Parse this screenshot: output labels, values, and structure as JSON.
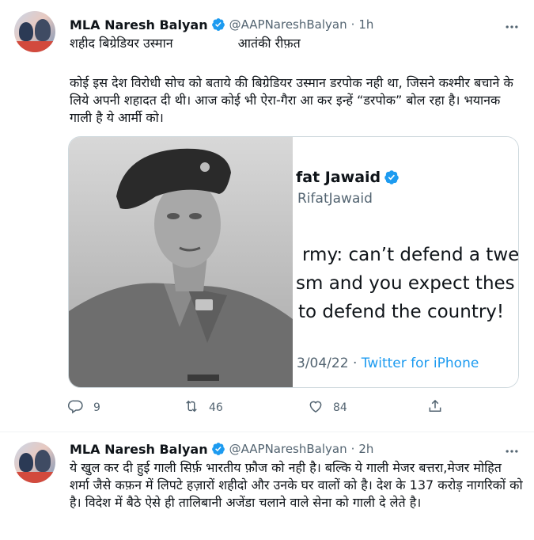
{
  "tweets": [
    {
      "author": "MLA Naresh Balyan",
      "handle": "@AAPNareshBalyan",
      "separator": "·",
      "time": "1h",
      "line1_left": "शहीद बिग्रेडियर उस्मान",
      "line1_right": "आतंकी रीफ़त",
      "body": "कोई इस देश विरोधी सोच को बताये की बिग्रेडियर उस्मान डरपोक नही था, जिसने कश्मीर बचाने के लिये अपनी शहादत दी थी। आज कोई भी ऐरा-गैरा आ कर इन्हें “डरपोक” बोल रहा है। भयानक गाली है ये आर्मी को।",
      "embedded": {
        "name": "fat Jawaid",
        "handle": "RifatJawaid",
        "line_a": "rmy: can’t defend a twe",
        "line_b": "sm and you expect thes",
        "line_c": "to defend the country!",
        "date": "3/04/22",
        "source": "Twitter for iPhone"
      },
      "replies": "9",
      "retweets": "46",
      "likes": "84"
    },
    {
      "author": "MLA Naresh Balyan",
      "handle": "@AAPNareshBalyan",
      "separator": "·",
      "time": "2h",
      "body": "ये खुल कर दी हुई गाली सिर्फ़ भारतीय फ़ौज को नही है। बल्कि ये गाली मेजर बत्तरा,मेजर मोहित शर्मा जैसे कफ़न में लिपटे हज़ारों शहीदो और उनके घर वालों को है। देश के 137 करोड़ नागरिकों को है। विदेश में बैठे ऐसे ही तालिबानी अजेंडा चलाने वाले सेना को गाली दे लेते है।"
    }
  ],
  "icons": {
    "verified": "verified-badge-icon",
    "more": "more-options-icon",
    "reply": "reply-icon",
    "retweet": "retweet-icon",
    "like": "like-icon",
    "share": "share-icon"
  },
  "colors": {
    "accent": "#1d9bf0",
    "text": "#0f1419",
    "secondary": "#536471",
    "border": "#cfd9de"
  }
}
